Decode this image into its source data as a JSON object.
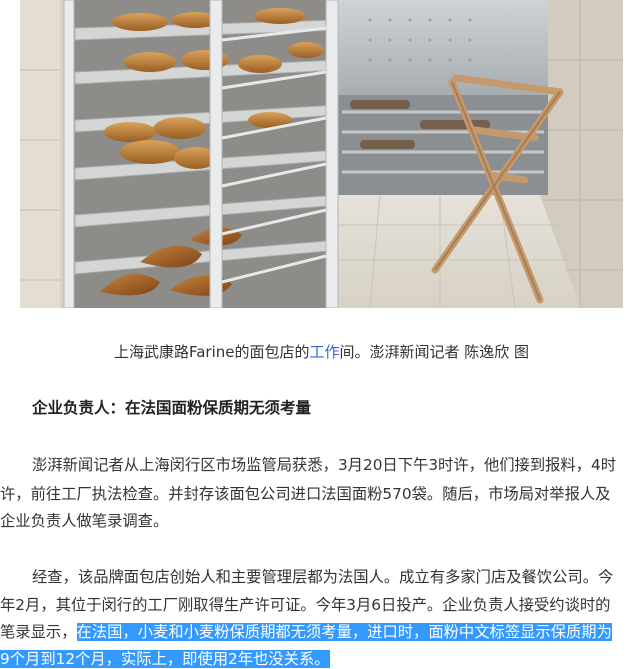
{
  "photo": {
    "icon": "bakery-workshop-photo"
  },
  "caption": {
    "before": "上海武康路Farine的面包店的",
    "link": "工作",
    "after": "间。澎湃新闻记者 陈逸欣 图"
  },
  "heading": "企业负责人：在法国面粉保质期无须考量",
  "paragraph1": {
    "lines": [
      "澎湃新闻记者从上海闵行区市场监管局获悉，3月20日下午3时许，他们接到报料，4时",
      "许，前往工厂执法检查。并封存该面包公司进口法国面粉570袋。随后，市场局对举报人及",
      "企业负责人做笔录调查。"
    ]
  },
  "paragraph2": {
    "line1": "经查，该品牌面包店创始人和主要管理层都为法国人。成立有多家门店及餐饮公司。今",
    "line2": "年2月，其位于闵行的工厂刚取得生产许可证。今年3月6日投产。企业负责人接受约谈时的",
    "line3_plain": "笔录显示，",
    "line3_highlight": "在法国，小麦和小麦粉保质期都无须考量，进口时，面粉中文标签显示保质期为",
    "line4_highlight": "9个月到12个月，实际上，即使用2年也没关系。"
  },
  "colors": {
    "highlight": "#3399ff",
    "link": "#3366cc",
    "text": "#333333"
  }
}
